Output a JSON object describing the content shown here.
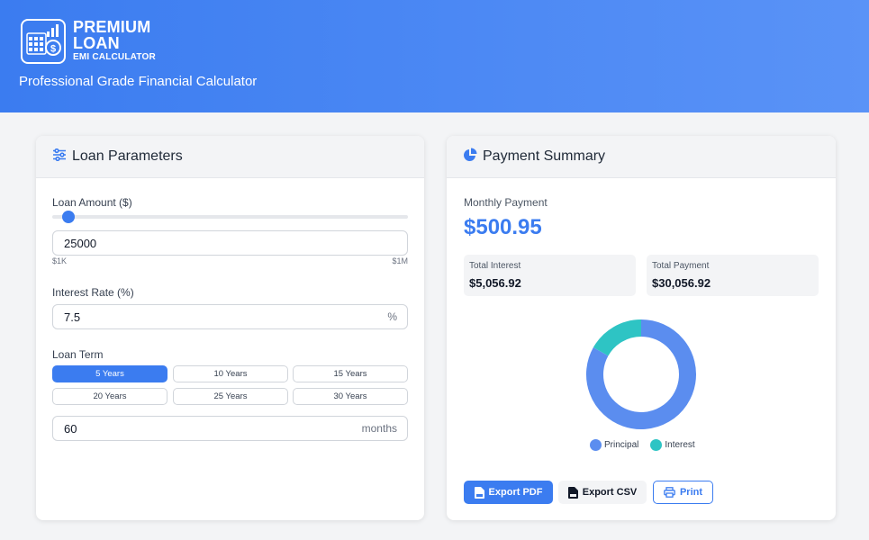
{
  "header": {
    "logo_line1": "PREMIUM",
    "logo_line2": "LOAN",
    "logo_line3": "EMI CALCULATOR",
    "tagline": "Professional Grade Financial Calculator"
  },
  "loan_parameters": {
    "title": "Loan Parameters",
    "title_icon": "sliders-icon",
    "loan_amount": {
      "label": "Loan Amount ($)",
      "value": "25000",
      "min_label": "$1K",
      "max_label": "$1M",
      "slider_fraction": 0.024
    },
    "interest_rate": {
      "label": "Interest Rate (%)",
      "value": "7.5",
      "suffix": "%"
    },
    "loan_term": {
      "label": "Loan Term",
      "options": [
        "5 Years",
        "10 Years",
        "15 Years",
        "20 Years",
        "25 Years",
        "30 Years"
      ],
      "selected": "5 Years",
      "months_value": "60",
      "months_suffix": "months"
    }
  },
  "payment_summary": {
    "title": "Payment Summary",
    "title_icon": "pie-chart-icon",
    "monthly_label": "Monthly Payment",
    "monthly_value": "$500.95",
    "total_interest_label": "Total Interest",
    "total_interest_value": "$5,056.92",
    "total_payment_label": "Total Payment",
    "total_payment_value": "$30,056.92",
    "legend_principal": "Principal",
    "legend_interest": "Interest",
    "export_pdf": "Export PDF",
    "export_csv": "Export CSV",
    "print": "Print"
  },
  "chart_data": {
    "type": "pie",
    "categories": [
      "Principal",
      "Interest"
    ],
    "values": [
      25000,
      5056.92
    ],
    "colors": [
      "#5b8def",
      "#2ec4c4"
    ],
    "legend_position": "bottom"
  },
  "colors": {
    "accent": "#3b7cf0",
    "principal": "#5b8def",
    "interest": "#2ec4c4"
  }
}
